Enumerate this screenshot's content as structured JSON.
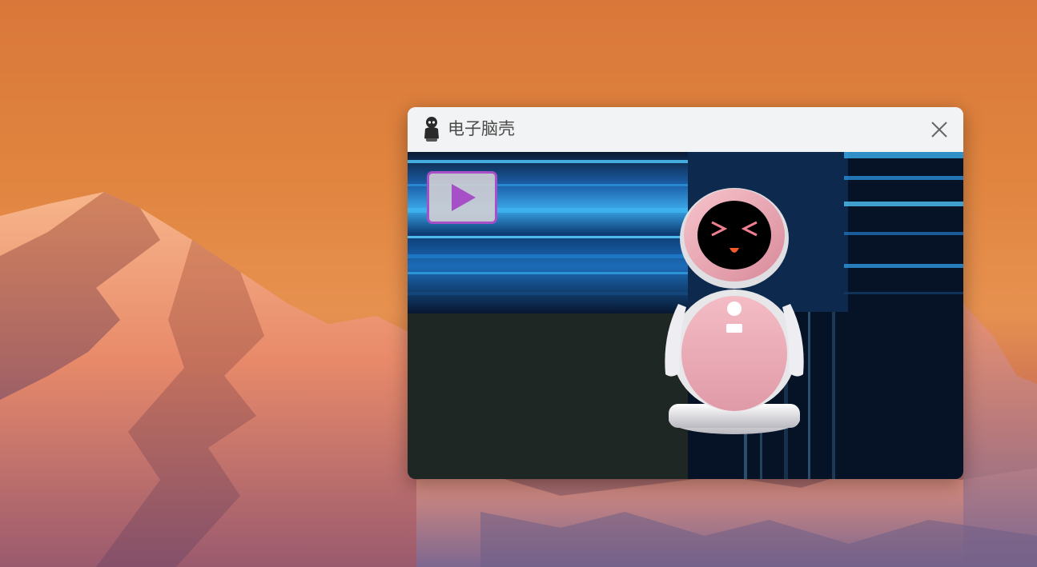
{
  "window": {
    "title": "电子脑壳"
  },
  "icons": {
    "app": "robot-icon",
    "close": "close-icon",
    "play": "play-icon"
  },
  "colors": {
    "accent": "#a64fc7",
    "robot_body": "#f0b3bd",
    "titlebar": "#f2f3f4"
  }
}
